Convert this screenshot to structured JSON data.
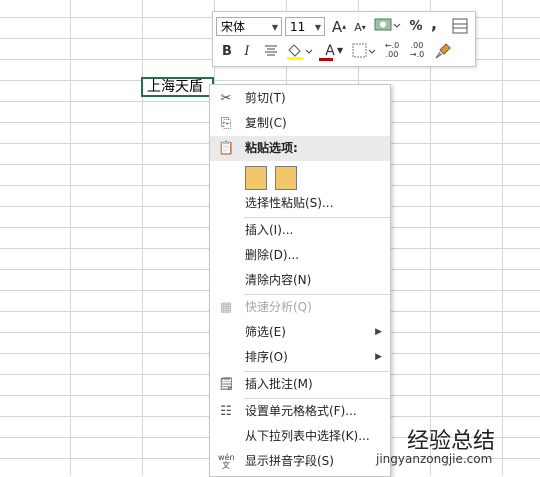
{
  "sheet": {
    "active_cell_value": "上海天盾"
  },
  "mini_toolbar": {
    "font_name": "宋体",
    "font_size": "11",
    "grow_font": "A",
    "shrink_font": "A",
    "percent": "%",
    "comma": ",",
    "bold": "B",
    "italic": "I",
    "font_color_letter": "A",
    "increase_decimal": "←.0 .00",
    "decrease_decimal": ".00 →.0"
  },
  "context_menu": {
    "cut": "剪切(T)",
    "copy": "复制(C)",
    "paste_options": "粘贴选项:",
    "paste_special": "选择性粘贴(S)...",
    "insert": "插入(I)...",
    "delete": "删除(D)...",
    "clear_contents": "清除内容(N)",
    "quick_analysis": "快速分析(Q)",
    "filter": "筛选(E)",
    "sort": "排序(O)",
    "insert_comment": "插入批注(M)",
    "format_cells": "设置单元格格式(F)...",
    "pick_from_list": "从下拉列表中选择(K)...",
    "phonetic": "显示拼音字段(S)",
    "phonetic_icon_text": "wén"
  },
  "watermark": {
    "title": "经验总结",
    "url": "jingyanzongjie.com"
  },
  "colors": {
    "accent": "#217346",
    "font_color": "#c00000",
    "fill_color": "#ffff00"
  }
}
